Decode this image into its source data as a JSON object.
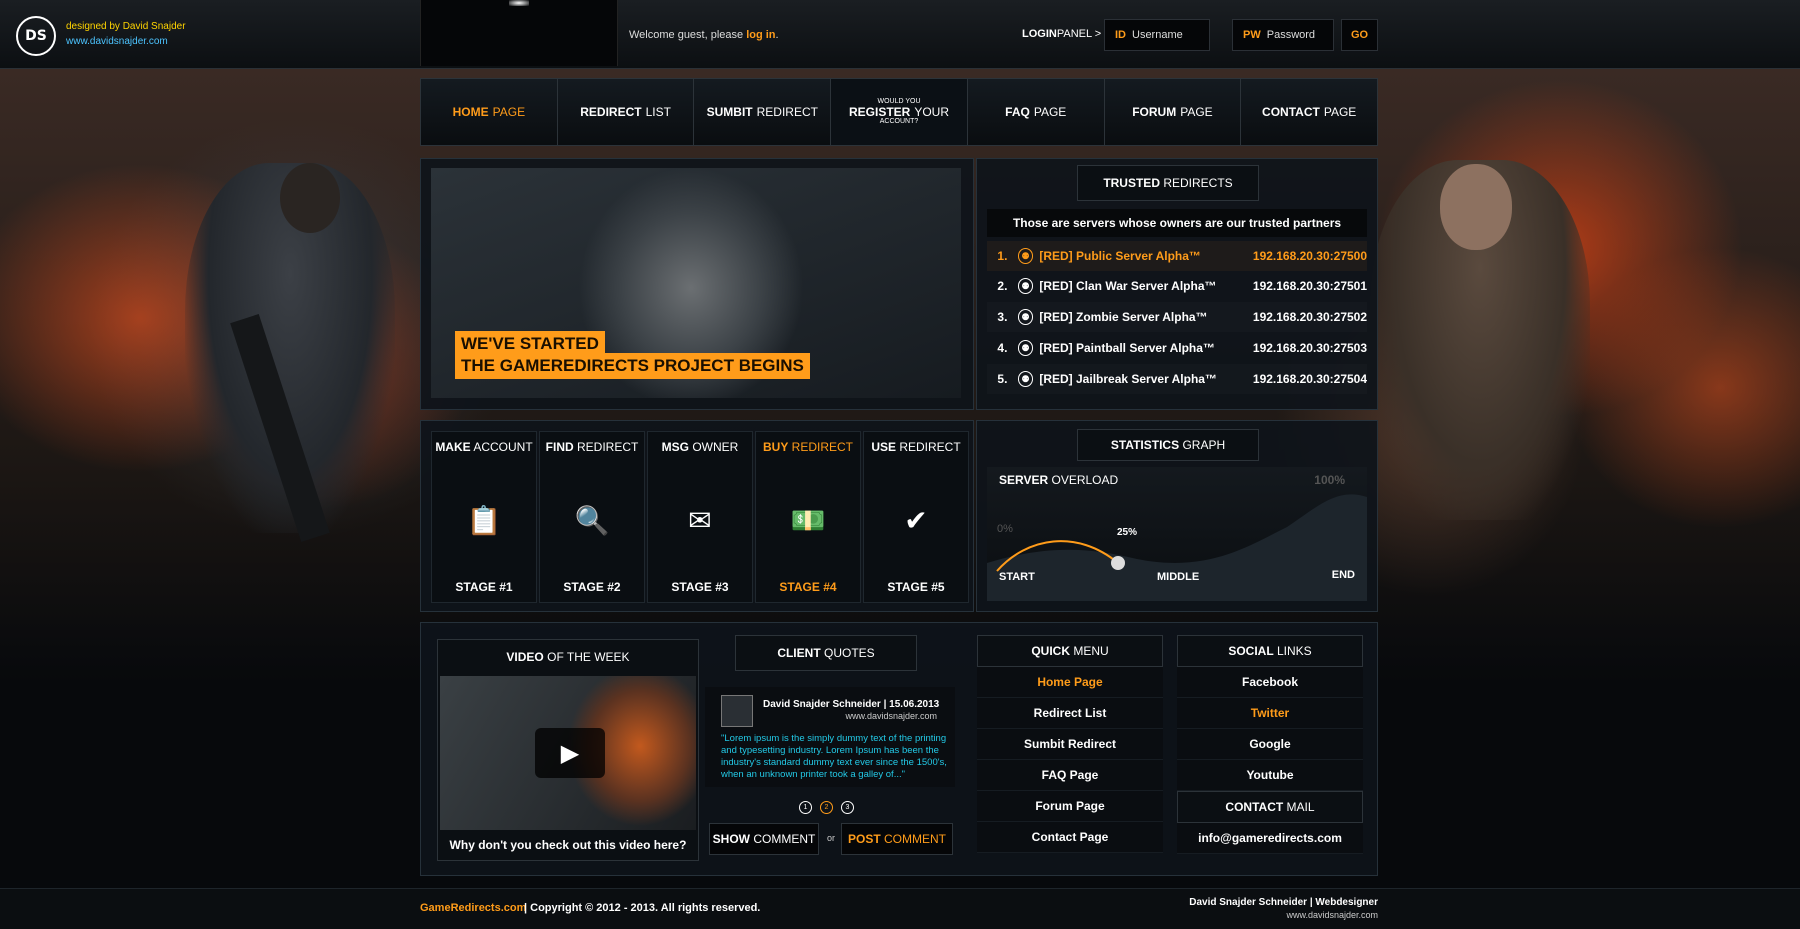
{
  "credits": {
    "designer": "designed by David Snajder",
    "site": "www.davidsnajder.com",
    "logo": "DS"
  },
  "top": {
    "welcome_text": "Welcome guest, please ",
    "login_link": "log in",
    "welcome_end": ".",
    "login_panel_bold": "LOGIN",
    "login_panel_rest": "PANEL >",
    "username_tag": "ID",
    "username_placeholder": "Username",
    "password_tag": "PW",
    "password_placeholder": "Password",
    "go": "GO"
  },
  "nav": [
    {
      "bold": "HOME",
      "rest": "PAGE"
    },
    {
      "bold": "REDIRECT",
      "rest": "LIST"
    },
    {
      "bold": "SUMBIT",
      "rest": "REDIRECT"
    },
    {
      "small_top": "WOULD YOU",
      "bold": "REGISTER",
      "rest": "YOUR",
      "small_bottom": "ACCOUNT?"
    },
    {
      "bold": "FAQ",
      "rest": "PAGE"
    },
    {
      "bold": "FORUM",
      "rest": "PAGE"
    },
    {
      "bold": "CONTACT",
      "rest": "PAGE"
    }
  ],
  "hero": {
    "line1": "WE'VE STARTED",
    "line2": "THE GAMEREDIRECTS PROJECT BEGINS"
  },
  "trusted": {
    "head_bold": "TRUSTED",
    "head_rest": "REDIRECTS",
    "subtitle": "Those are servers whose owners are our trusted partners",
    "servers": [
      {
        "num": "1.",
        "name": "[RED] Public Server Alpha™",
        "ip": "192.168.20.30:27500"
      },
      {
        "num": "2.",
        "name": "[RED] Clan War Server Alpha™",
        "ip": "192.168.20.30:27501"
      },
      {
        "num": "3.",
        "name": "[RED] Zombie Server Alpha™",
        "ip": "192.168.20.30:27502"
      },
      {
        "num": "4.",
        "name": "[RED] Paintball Server Alpha™",
        "ip": "192.168.20.30:27503"
      },
      {
        "num": "5.",
        "name": "[RED] Jailbreak Server Alpha™",
        "ip": "192.168.20.30:27504"
      }
    ]
  },
  "stages": [
    {
      "bold": "MAKE",
      "rest": "ACCOUNT",
      "icon": "clipboard-icon",
      "glyph": "📋",
      "stage": "STAGE #1"
    },
    {
      "bold": "FIND",
      "rest": "REDIRECT",
      "icon": "search-icon",
      "glyph": "🔍",
      "stage": "STAGE #2"
    },
    {
      "bold": "MSG",
      "rest": "OWNER",
      "icon": "envelope-icon",
      "glyph": "✉",
      "stage": "STAGE #3"
    },
    {
      "bold": "BUY",
      "rest": "REDIRECT",
      "icon": "money-icon",
      "glyph": "💵",
      "stage": "STAGE #4"
    },
    {
      "bold": "USE",
      "rest": "REDIRECT",
      "icon": "check-icon",
      "glyph": "✔",
      "stage": "STAGE #5"
    }
  ],
  "stats": {
    "head_bold": "STATISTICS",
    "head_rest": "GRAPH",
    "label_bold": "SERVER",
    "label_rest": "OVERLOAD",
    "max": "100%",
    "min": "0%",
    "current": "25%",
    "current_value": 0.25,
    "start": "START",
    "middle": "MIDDLE",
    "end": "END"
  },
  "video": {
    "title_bold": "VIDEO",
    "title_rest": "OF THE WEEK",
    "caption": "Why don't you check out this video here?"
  },
  "quotes": {
    "head_bold": "CLIENT",
    "head_rest": "QUOTES",
    "author": "David Snajder Schneider | 15.06.2013",
    "site": "www.davidsnajder.com",
    "text": "\"Lorem ipsum is the simply dummy text of the printing and typesetting industry. Lorem Ipsum has been the industry's standard dummy text ever since the 1500's, when an unknown printer took a galley of...\"",
    "pages": [
      "1",
      "2",
      "3"
    ],
    "show_bold": "SHOW",
    "show_rest": "COMMENT",
    "or": "or",
    "post_bold": "POST",
    "post_rest": "COMMENT"
  },
  "quick_menu": {
    "head_bold": "QUICK",
    "head_rest": "MENU",
    "items": [
      "Home Page",
      "Redirect List",
      "Sumbit Redirect",
      "FAQ Page",
      "Forum Page",
      "Contact Page"
    ]
  },
  "social": {
    "head_bold": "SOCIAL",
    "head_rest": "LINKS",
    "items": [
      "Facebook",
      "Twitter",
      "Google",
      "Youtube"
    ],
    "contact_bold": "CONTACT",
    "contact_rest": "MAIL",
    "email": "info@gameredirects.com"
  },
  "footer": {
    "brand": "GameRedirects.com",
    "copy": "| Copyright © 2012 - 2013. All rights reserved.",
    "author": "David Snajder Schneider | Webdesigner",
    "author_site": "www.davidsnajder.com"
  },
  "colors": {
    "accent": "#ff9c1a",
    "cyan": "#23c9e6",
    "credit_yellow": "#ffd400",
    "credit_blue": "#4cc4ff"
  }
}
